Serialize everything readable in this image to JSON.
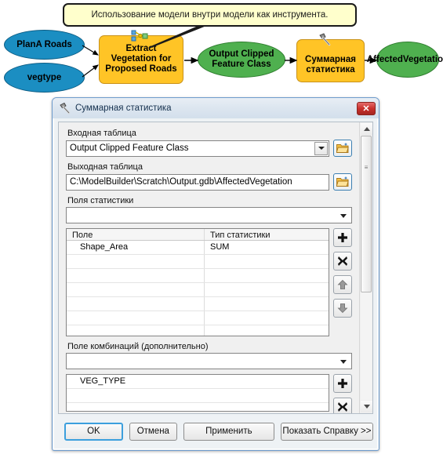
{
  "diagram": {
    "callout": {
      "text": "Использование модели внутри модели как инструмента."
    },
    "nodes": [
      {
        "id": "plana-roads",
        "label": "PlanA Roads",
        "shape": "ellipse",
        "color": "#1b8ec2"
      },
      {
        "id": "vegtype",
        "label": "vegtype",
        "shape": "ellipse",
        "color": "#1b8ec2"
      },
      {
        "id": "extract-vegetation",
        "label": "Extract Vegetation for Proposed Roads",
        "shape": "rect",
        "color": "#ffc426",
        "icon": "model-tool-icon"
      },
      {
        "id": "output-clipped",
        "label": "Output Clipped Feature Class",
        "shape": "ellipse",
        "color": "#4fb04f"
      },
      {
        "id": "summary-statistics",
        "label": "Суммарная статистика",
        "shape": "rect",
        "color": "#ffc426",
        "icon": "hammer-icon"
      },
      {
        "id": "affected-vegetation",
        "label": "AffectedVegetation",
        "shape": "ellipse",
        "color": "#4fb04f"
      }
    ]
  },
  "dialog": {
    "title": "Суммарная статистика",
    "close_label": "✕",
    "input_table": {
      "label": "Входная таблица",
      "value": "Output Clipped Feature Class",
      "browse_label": "Обзор"
    },
    "output_table": {
      "label": "Выходная таблица",
      "value": "C:\\ModelBuilder\\Scratch\\Output.gdb\\AffectedVegetation",
      "browse_label": "Обзор"
    },
    "statistics_fields": {
      "label": "Поля статистики",
      "selected": "",
      "columns": [
        "Поле",
        "Тип статистики"
      ],
      "rows": [
        {
          "field": "Shape_Area",
          "stat_type": "SUM"
        },
        {
          "field": "",
          "stat_type": ""
        },
        {
          "field": "",
          "stat_type": ""
        },
        {
          "field": "",
          "stat_type": ""
        },
        {
          "field": "",
          "stat_type": ""
        },
        {
          "field": "",
          "stat_type": ""
        },
        {
          "field": "",
          "stat_type": ""
        }
      ],
      "buttons": [
        "add",
        "delete",
        "move-up",
        "move-down"
      ]
    },
    "case_field": {
      "label": "Поле комбинаций (дополнительно)",
      "selected": "",
      "rows": [
        "VEG_TYPE",
        "",
        ""
      ]
    },
    "buttons": {
      "ok": "OK",
      "cancel": "Отмена",
      "apply": "Применить",
      "help": "Показать Справку >>"
    }
  }
}
